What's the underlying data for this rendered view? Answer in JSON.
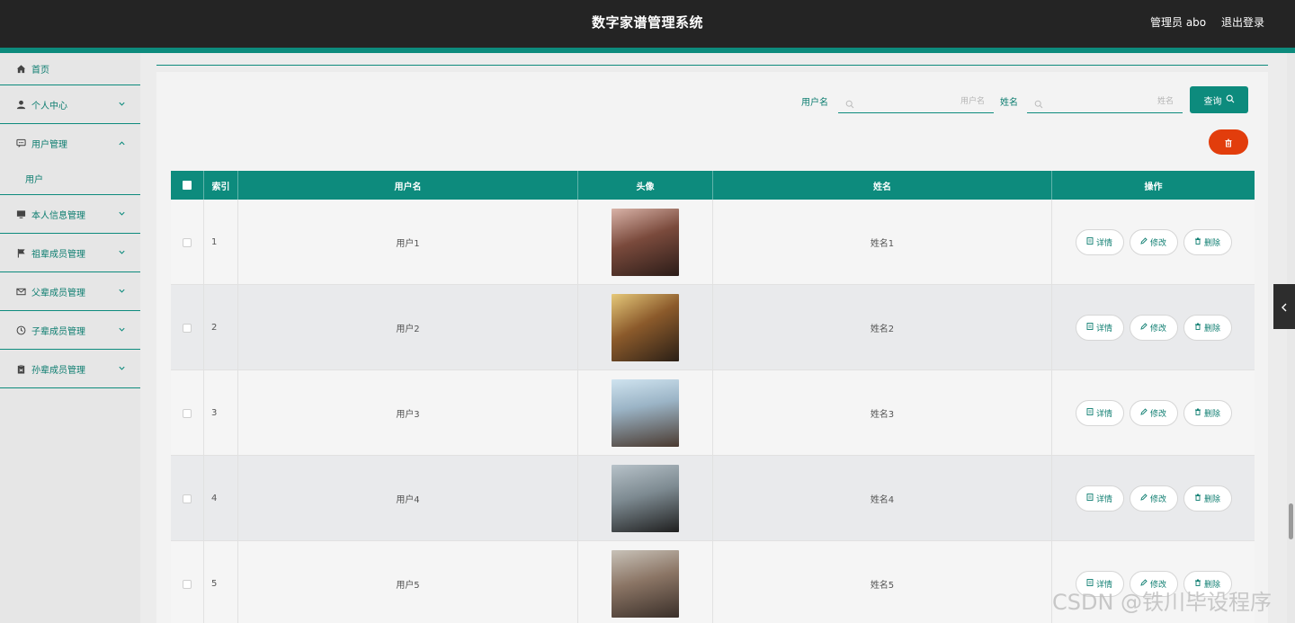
{
  "header": {
    "title": "数字家谱管理系统",
    "user": "管理员 abo",
    "logout": "退出登录"
  },
  "sidebar": {
    "items": [
      {
        "label": "首页",
        "icon": "home-icon"
      },
      {
        "label": "个人中心",
        "icon": "user-icon"
      },
      {
        "label": "用户管理",
        "icon": "chat-icon",
        "expanded": true,
        "children": [
          "用户"
        ]
      },
      {
        "label": "本人信息管理",
        "icon": "monitor-icon"
      },
      {
        "label": "祖辈成员管理",
        "icon": "flag-icon"
      },
      {
        "label": "父辈成员管理",
        "icon": "mail-icon"
      },
      {
        "label": "子辈成员管理",
        "icon": "clock-icon"
      },
      {
        "label": "孙辈成员管理",
        "icon": "clipboard-icon"
      }
    ]
  },
  "search": {
    "username_label": "用户名",
    "username_placeholder": "用户名",
    "name_label": "姓名",
    "name_placeholder": "姓名",
    "query_button": "查询"
  },
  "table": {
    "headers": [
      "索引",
      "用户名",
      "头像",
      "姓名",
      "操作"
    ],
    "actions": [
      "详情",
      "修改",
      "删除"
    ],
    "rows": [
      {
        "index": "1",
        "username": "用户1",
        "name": "姓名1"
      },
      {
        "index": "2",
        "username": "用户2",
        "name": "姓名2"
      },
      {
        "index": "3",
        "username": "用户3",
        "name": "姓名3"
      },
      {
        "index": "4",
        "username": "用户4",
        "name": "姓名4"
      },
      {
        "index": "5",
        "username": "用户5",
        "name": "姓名5"
      }
    ]
  },
  "watermark": "CSDN @铁川毕设程序",
  "colors": {
    "accent": "#0d8b7d",
    "header_bg": "#242424",
    "danger": "#e23d0c"
  }
}
